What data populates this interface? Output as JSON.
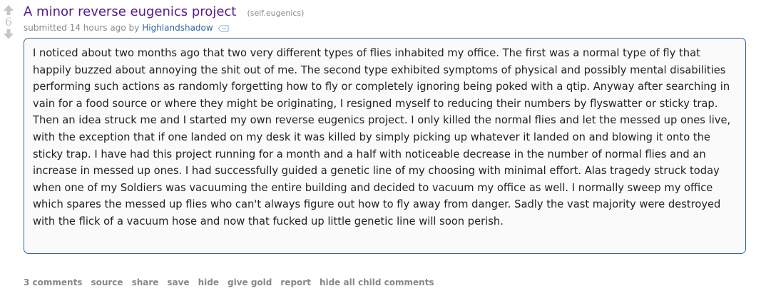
{
  "vote": {
    "score": "6"
  },
  "post": {
    "title": "A minor reverse eugenics project",
    "domain": "(self.eugenics)",
    "submitted_prefix": "submitted 14 hours ago by",
    "author": "Highlandshadow",
    "body": "I noticed about two months ago that two very different types of flies inhabited my office. The first was a normal type of fly that happily buzzed about annoying the shit out of me. The second type exhibited symptoms of physical and possibly mental disabilities performing such actions as randomly forgetting how to fly or completely ignoring being poked with a qtip. Anyway after searching in vain for a food source or where they might be originating, I resigned myself to reducing their numbers by flyswatter or sticky trap. Then an idea struck me and I started my own reverse eugenics project. I only killed the normal flies and let the messed up ones live, with the exception that if one landed on my desk it was killed by simply picking up whatever it landed on and blowing it onto the sticky trap. I have had this project running for a month and a half with noticeable decrease in the number of normal flies and an increase in messed up ones. I had successfully guided a genetic line of my choosing with minimal effort. Alas tragedy struck today when one of my Soldiers was vacuuming the entire building and decided to vacuum my office as well. I normally sweep my office which spares the messed up flies who can't always figure out how to fly away from danger. Sadly the vast majority were destroyed with the flick of a vacuum hose and now that fucked up little genetic line will soon perish."
  },
  "buttons": {
    "comments": "3 comments",
    "source": "source",
    "share": "share",
    "save": "save",
    "hide": "hide",
    "give_gold": "give gold",
    "report": "report",
    "hide_child": "hide all child comments"
  },
  "colors": {
    "title": "#551a8b",
    "author": "#336699",
    "border": "#336699",
    "muted": "#888888",
    "arrow": "#c6c6c6"
  },
  "icons": [
    "upvote-icon",
    "downvote-icon",
    "author-tag-icon"
  ]
}
